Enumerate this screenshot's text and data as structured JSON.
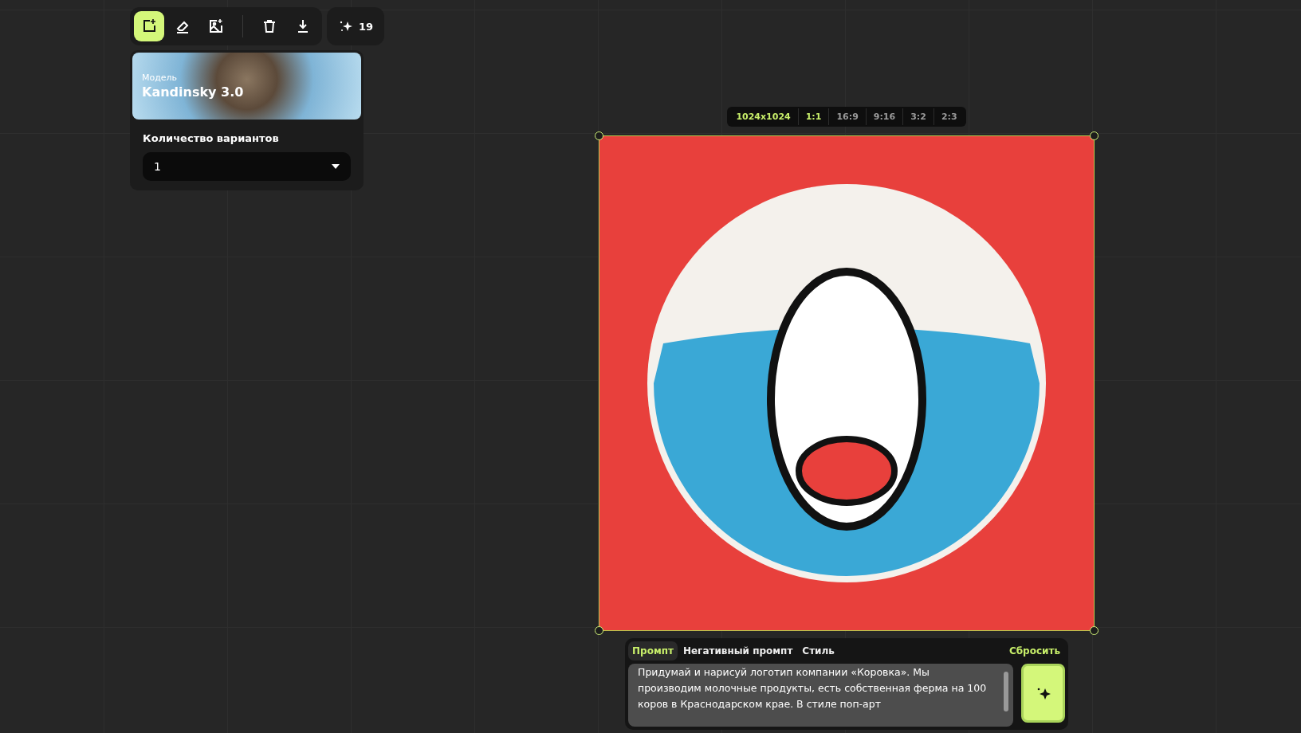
{
  "toolbar": {
    "tools": [
      {
        "kind": "add-image",
        "selected": true
      },
      {
        "kind": "eraser",
        "selected": false
      },
      {
        "kind": "image-edit",
        "selected": false
      },
      {
        "kind": "trash",
        "selected": false
      },
      {
        "kind": "download",
        "selected": false
      }
    ],
    "credits": "19"
  },
  "settings": {
    "model_label": "Модель",
    "model_name": "Kandinsky 3.0",
    "variants_label": "Количество вариантов",
    "variants_value": "1"
  },
  "size_bar": {
    "resolution": "1024x1024",
    "ratios": [
      {
        "label": "1:1",
        "selected": true
      },
      {
        "label": "16:9",
        "selected": false
      },
      {
        "label": "9:16",
        "selected": false
      },
      {
        "label": "3:2",
        "selected": false
      },
      {
        "label": "2:3",
        "selected": false
      }
    ]
  },
  "prompt_panel": {
    "tabs": [
      {
        "label": "Промпт",
        "selected": true
      },
      {
        "label": "Негативный промпт",
        "selected": false
      },
      {
        "label": "Стиль",
        "selected": false
      }
    ],
    "reset": "Сбросить",
    "prompt": "Придумай и нарисуй логотип компании «Коровка». Мы производим молочные продукты, есть собственная ферма на 100 коров в Краснодарском крае. В стиле поп-арт"
  }
}
